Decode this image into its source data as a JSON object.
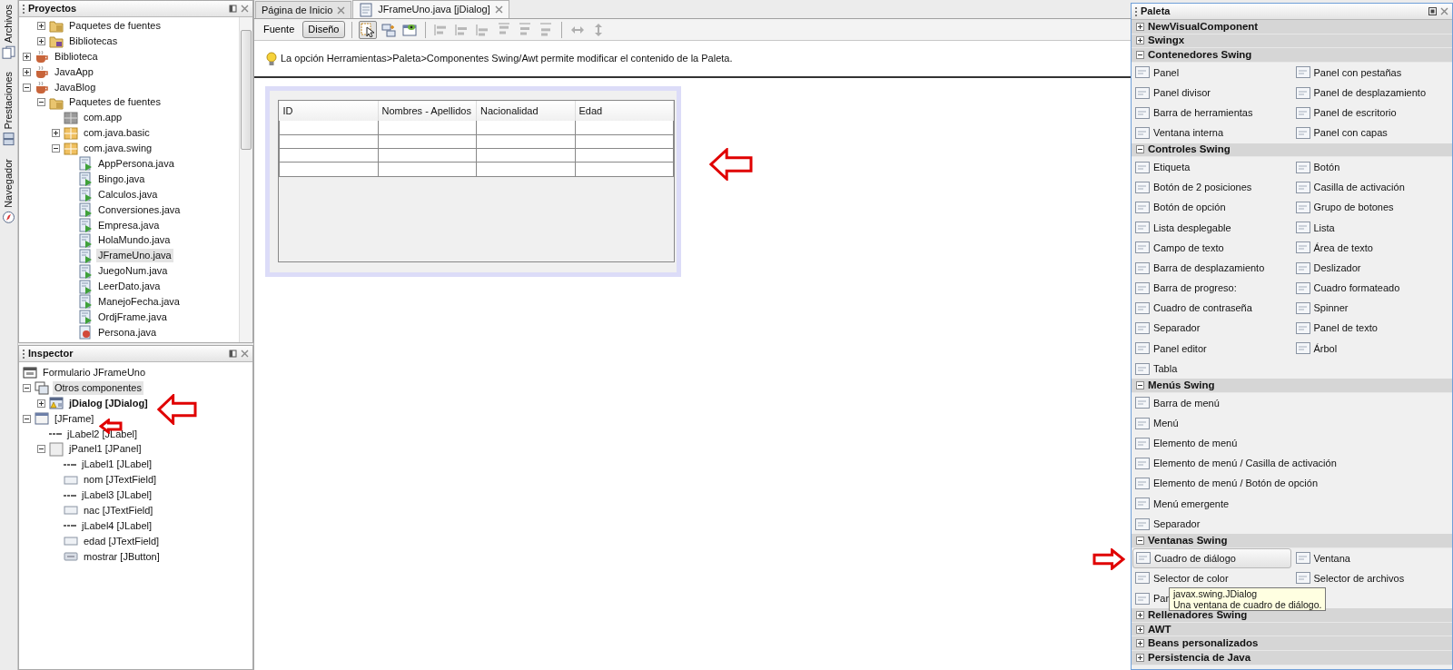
{
  "side_tabs": [
    {
      "label": "Archivos"
    },
    {
      "label": "Prestaciones"
    },
    {
      "label": "Navegador"
    }
  ],
  "projects": {
    "title": "Proyectos",
    "scrolled_children": [
      {
        "label": "Paquetes de fuentes",
        "kind": "folder",
        "expanded": false,
        "selected": false
      },
      {
        "label": "Bibliotecas",
        "kind": "library",
        "expanded": false,
        "selected": false
      }
    ],
    "tree": [
      {
        "label": "Biblioteca",
        "kind": "project",
        "expanded": false,
        "selected": false
      },
      {
        "label": "JavaApp",
        "kind": "project",
        "expanded": false,
        "selected": false
      },
      {
        "label": "JavaBlog",
        "kind": "project",
        "expanded": true,
        "selected": false,
        "children": [
          {
            "label": "Paquetes de fuentes",
            "kind": "folder",
            "expanded": true,
            "selected": false,
            "children": [
              {
                "label": "com.app",
                "kind": "empty-package",
                "selected": false
              },
              {
                "label": "com.java.basic",
                "kind": "package",
                "expanded": false,
                "selected": false
              },
              {
                "label": "com.java.swing",
                "kind": "package",
                "expanded": true,
                "selected": false,
                "children": [
                  {
                    "label": "AppPersona.java",
                    "kind": "class",
                    "selected": false
                  },
                  {
                    "label": "Bingo.java",
                    "kind": "class",
                    "selected": false
                  },
                  {
                    "label": "Calculos.java",
                    "kind": "class",
                    "selected": false
                  },
                  {
                    "label": "Conversiones.java",
                    "kind": "class",
                    "selected": false
                  },
                  {
                    "label": "Empresa.java",
                    "kind": "class",
                    "selected": false
                  },
                  {
                    "label": "HolaMundo.java",
                    "kind": "class",
                    "selected": false
                  },
                  {
                    "label": "JFrameUno.java",
                    "kind": "class",
                    "selected": true
                  },
                  {
                    "label": "JuegoNum.java",
                    "kind": "class",
                    "selected": false
                  },
                  {
                    "label": "LeerDato.java",
                    "kind": "class",
                    "selected": false
                  },
                  {
                    "label": "ManejoFecha.java",
                    "kind": "class",
                    "selected": false
                  },
                  {
                    "label": "OrdjFrame.java",
                    "kind": "class",
                    "selected": false
                  },
                  {
                    "label": "Persona.java",
                    "kind": "bean",
                    "selected": false
                  }
                ]
              }
            ]
          }
        ]
      }
    ]
  },
  "inspector": {
    "title": "Inspector",
    "tree": [
      {
        "label": "Formulario JFrameUno",
        "kind": "form",
        "selected": false,
        "children": [
          {
            "label": "Otros componentes",
            "kind": "group",
            "expanded": true,
            "selected": true,
            "children": [
              {
                "label": "jDialog [JDialog]",
                "kind": "dialog",
                "expanded": false,
                "selected": false,
                "designing": true
              }
            ]
          },
          {
            "label": "[JFrame]",
            "kind": "frame",
            "expanded": true,
            "selected": false,
            "children": [
              {
                "label": "jLabel2 [JLabel]",
                "kind": "label",
                "selected": false
              },
              {
                "label": "jPanel1 [JPanel]",
                "kind": "panel",
                "expanded": true,
                "selected": false,
                "children": [
                  {
                    "label": "jLabel1 [JLabel]",
                    "kind": "label",
                    "selected": false
                  },
                  {
                    "label": "nom [JTextField]",
                    "kind": "field",
                    "selected": false
                  },
                  {
                    "label": "jLabel3 [JLabel]",
                    "kind": "label",
                    "selected": false
                  },
                  {
                    "label": "nac [JTextField]",
                    "kind": "field",
                    "selected": false
                  },
                  {
                    "label": "jLabel4 [JLabel]",
                    "kind": "label",
                    "selected": false
                  },
                  {
                    "label": "edad [JTextField]",
                    "kind": "field",
                    "selected": false
                  },
                  {
                    "label": "mostrar [JButton]",
                    "kind": "button",
                    "selected": false
                  }
                ]
              }
            ]
          }
        ]
      }
    ]
  },
  "editor": {
    "tabs": [
      {
        "label": "Página de Inicio",
        "selected": false,
        "kind": "page"
      },
      {
        "label": "JFrameUno.java [jDialog]",
        "selected": true,
        "kind": "file"
      }
    ],
    "modes": [
      {
        "label": "Fuente",
        "selected": false
      },
      {
        "label": "Diseño",
        "selected": true
      }
    ],
    "tools": [
      {
        "selected": true
      },
      {
        "selected": false
      },
      {
        "selected": false
      }
    ],
    "align_tools": [
      {
        "disabled": true
      },
      {
        "disabled": true
      },
      {
        "disabled": true
      },
      {
        "disabled": true
      },
      {
        "disabled": true
      },
      {
        "disabled": true
      }
    ],
    "resize_tools": [
      {
        "disabled": true
      },
      {
        "disabled": true
      }
    ],
    "hint": "La opción Herramientas>Paleta>Componentes Swing/Awt permite modificar el contenido de la Paleta.",
    "table": {
      "columns": [
        "ID",
        "Nombres - Apellidos",
        "Nacionalidad",
        "Edad"
      ]
    }
  },
  "palette": {
    "title": "Paleta",
    "categories": [
      {
        "name": "NewVisualComponent",
        "expanded": false
      },
      {
        "name": "Swingx",
        "expanded": false
      },
      {
        "name": "Contenedores Swing",
        "expanded": true,
        "items": [
          {
            "label": "Panel",
            "selected": false
          },
          {
            "label": "Panel con pestañas",
            "selected": false
          },
          {
            "label": "Panel divisor",
            "selected": false
          },
          {
            "label": "Panel de desplazamiento",
            "selected": false
          },
          {
            "label": "Barra de herramientas",
            "selected": false
          },
          {
            "label": "Panel de escritorio",
            "selected": false
          },
          {
            "label": "Ventana interna",
            "selected": false
          },
          {
            "label": "Panel con capas",
            "selected": false
          }
        ]
      },
      {
        "name": "Controles Swing",
        "expanded": true,
        "items": [
          {
            "label": "Etiqueta",
            "selected": false
          },
          {
            "label": "Botón",
            "selected": false
          },
          {
            "label": "Botón de 2 posiciones",
            "selected": false
          },
          {
            "label": "Casilla de activación",
            "selected": false
          },
          {
            "label": "Botón de opción",
            "selected": false
          },
          {
            "label": "Grupo de botones",
            "selected": false
          },
          {
            "label": "Lista desplegable",
            "selected": false
          },
          {
            "label": "Lista",
            "selected": false
          },
          {
            "label": "Campo de texto",
            "selected": false
          },
          {
            "label": "Área de texto",
            "selected": false
          },
          {
            "label": "Barra de desplazamiento",
            "selected": false
          },
          {
            "label": "Deslizador",
            "selected": false
          },
          {
            "label": "Barra de progreso:",
            "selected": false
          },
          {
            "label": "Cuadro formateado",
            "selected": false
          },
          {
            "label": "Cuadro de contraseña",
            "selected": false
          },
          {
            "label": "Spinner",
            "selected": false
          },
          {
            "label": "Separador",
            "selected": false
          },
          {
            "label": "Panel de texto",
            "selected": false
          },
          {
            "label": "Panel editor",
            "selected": false
          },
          {
            "label": "Árbol",
            "selected": false
          },
          {
            "label": "Tabla",
            "selected": false
          }
        ]
      },
      {
        "name": "Menús Swing",
        "expanded": true,
        "items": [
          {
            "label": "Barra de menú",
            "selected": false
          },
          {
            "label": "Menú",
            "selected": false
          },
          {
            "label": "Elemento de menú",
            "selected": false
          },
          {
            "label": "Elemento de menú / Casilla de activación",
            "selected": false
          },
          {
            "label": "Elemento de menú / Botón de opción",
            "selected": false
          },
          {
            "label": "Menú emergente",
            "selected": false
          },
          {
            "label": "Separador",
            "selected": false
          }
        ]
      },
      {
        "name": "Ventanas Swing",
        "expanded": true,
        "items": [
          {
            "label": "Cuadro de diálogo",
            "selected": true
          },
          {
            "label": "Ventana",
            "selected": false
          },
          {
            "label": "Selector de color",
            "selected": false
          },
          {
            "label": "Selector de archivos",
            "selected": false
          },
          {
            "label": "Par",
            "selected": false
          }
        ]
      },
      {
        "name": "Rellenadores Swing",
        "expanded": false
      },
      {
        "name": "AWT",
        "expanded": false
      },
      {
        "name": "Beans personalizados",
        "expanded": false
      },
      {
        "name": "Persistencia de Java",
        "expanded": false
      }
    ],
    "tooltip": {
      "title": "javax.swing.JDialog",
      "text": "Una ventana de cuadro de diálogo."
    }
  }
}
